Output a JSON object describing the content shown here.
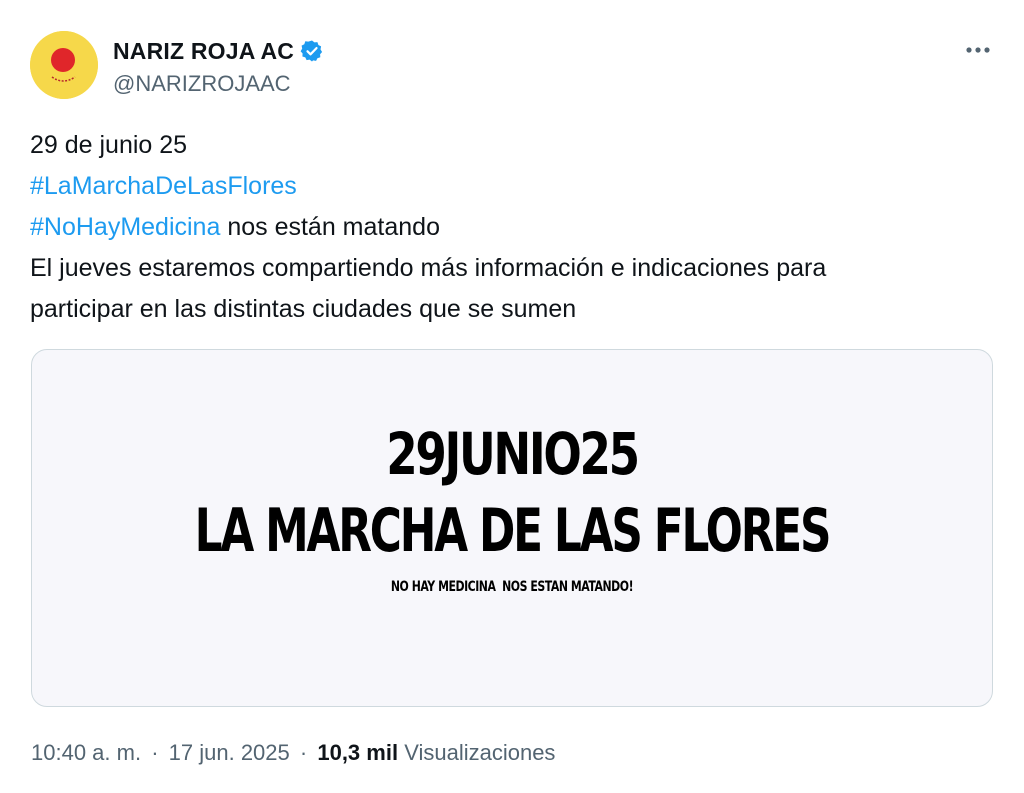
{
  "author": {
    "display_name": "NARIZ ROJA AC",
    "handle": "@NARIZROJAAC",
    "avatar_icon": "red-nose-smile-icon",
    "verified_icon": "verified-badge-icon"
  },
  "post": {
    "line1": "29 de junio 25",
    "hashtag1": "#LaMarchaDeLasFlores",
    "hashtag2": "#NoHayMedicina",
    "line3_rest": " nos están matando",
    "line4": "El jueves estaremos compartiendo más información e indicaciones para",
    "line5": "participar en las distintas ciudades que se sumen"
  },
  "media": {
    "date_text": "29JUNIO25",
    "title_text": "LA MARCHA DE LAS FLORES",
    "subtitle_text": "NO HAY MEDICINA  NOS ESTAN MATANDO!"
  },
  "meta": {
    "time": "10:40 a. m.",
    "separator": "·",
    "date": "17 jun. 2025",
    "views_count": "10,3 mil",
    "views_label": "Visualizaciones"
  },
  "more_icon": "more-options-icon",
  "colors": {
    "link": "#1d9bf0",
    "secondary_text": "#536471",
    "verified": "#1d9bf0",
    "avatar_bg": "#f6d84a",
    "nose": "#e0262a"
  }
}
